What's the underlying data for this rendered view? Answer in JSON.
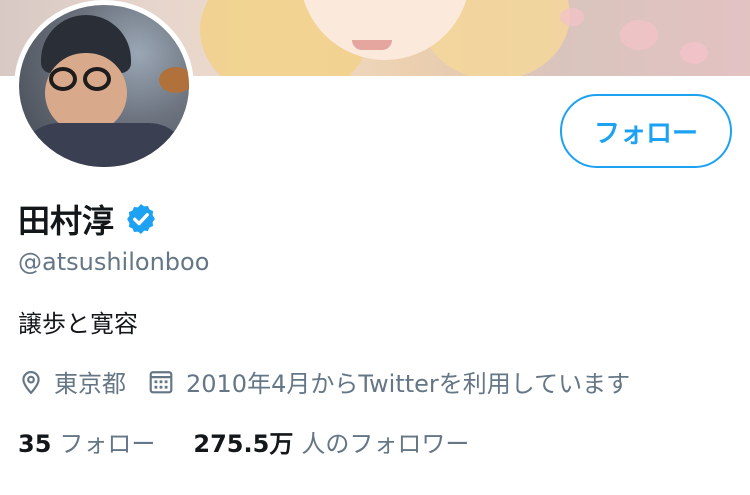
{
  "profile": {
    "name": "田村淳",
    "handle": "@atsushilonboo",
    "bio": "譲歩と寛容",
    "location": "東京都",
    "joined": "2010年4月からTwitterを利用しています",
    "verified_icon": "verified-badge-icon",
    "location_icon": "location-pin-icon",
    "calendar_icon": "calendar-icon"
  },
  "actions": {
    "follow_label": "フォロー"
  },
  "stats": {
    "following_count": "35",
    "following_label": "フォロー",
    "followers_count": "275.5万",
    "followers_label": "人のフォロワー"
  },
  "colors": {
    "accent": "#1da1f2",
    "secondary_text": "#657786",
    "primary_text": "#14171a"
  }
}
